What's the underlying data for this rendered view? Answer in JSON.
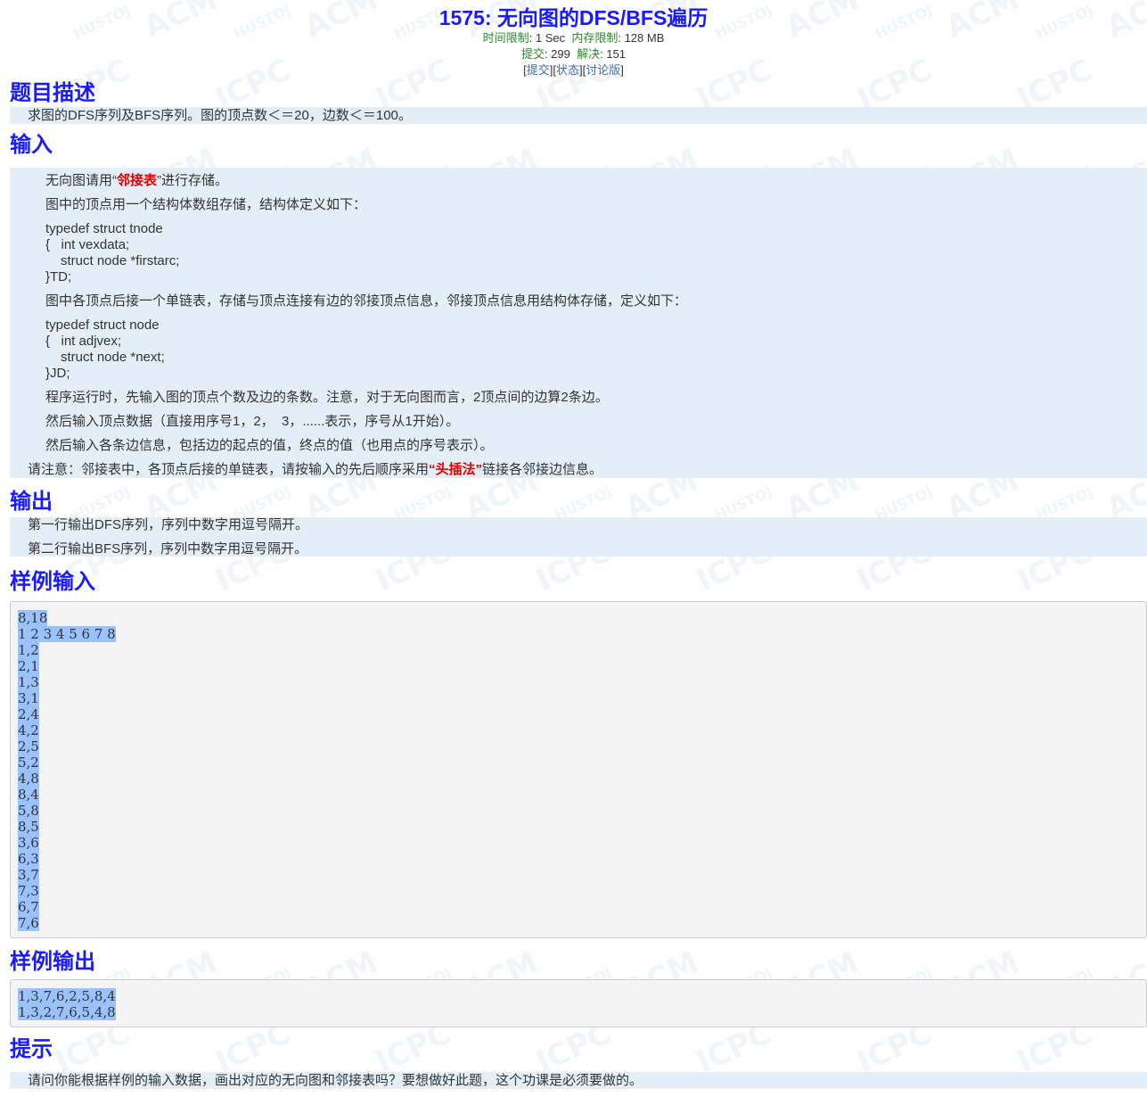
{
  "problem": {
    "title": "1575: 无向图的DFS/BFS遍历",
    "time_limit_label": "时间限制",
    "time_limit": ": 1 Sec",
    "memory_limit_label": "内存限制",
    "memory_limit": ": 128 MB",
    "submit_label": "提交",
    "submit_count": ": 299",
    "solved_label": "解决",
    "solved_count": ": 151",
    "link_submit": "提交",
    "link_status": "状态",
    "link_discuss": "讨论版",
    "bracket_open": "[",
    "bracket_close": "]"
  },
  "sections": {
    "description_title": "题目描述",
    "input_title": "输入",
    "output_title": "输出",
    "sample_input_title": "样例输入",
    "sample_output_title": "样例输出",
    "hint_title": "提示"
  },
  "description": "求图的DFS序列及BFS序列。图的顶点数＜＝20，边数＜＝100。",
  "input": {
    "p1_pre": "无向图请用“",
    "p1_red": "邻接表",
    "p1_post": "”进行存储。",
    "p2": "图中的顶点用一个结构体数组存储，结构体定义如下：",
    "code1": [
      "typedef struct tnode",
      "{   int vexdata;",
      "struct node *firstarc;",
      "}TD;"
    ],
    "p3": "图中各顶点后接一个单链表，存储与顶点连接有边的邻接顶点信息，邻接顶点信息用结构体存储，定义如下：",
    "code2": [
      "typedef struct node",
      "{   int adjvex;",
      "struct node *next;",
      "}JD;"
    ],
    "p4": "程序运行时，先输入图的顶点个数及边的条数。注意，对于无向图而言，2顶点间的边算2条边。",
    "p5": "然后输入顶点数据（直接用序号1，2，  3，......表示，序号从1开始）。",
    "p6": "然后输入各条边信息，包括边的起点的值，终点的值（也用点的序号表示）。",
    "note_pre": "请注意：邻接表中，各顶点后接的单链表，请按输入的先后顺序采用",
    "note_red": "“头插法”",
    "note_post": "链接各邻接边信息。"
  },
  "output": {
    "line1": "第一行输出DFS序列，序列中数字用逗号隔开。",
    "line2": "第二行输出BFS序列，序列中数字用逗号隔开。"
  },
  "sample_input": [
    "8,18",
    "1 2 3 4 5 6 7 8",
    "1,2",
    "2,1",
    "1,3",
    "3,1",
    "2,4",
    "4,2",
    "2,5",
    "5,2",
    "4,8",
    "8,4",
    "5,8",
    "8,5",
    "3,6",
    "6,3",
    "3,7",
    "7,3",
    "6,7",
    "7,6"
  ],
  "sample_output": [
    "1,3,7,6,2,5,8,4",
    "1,3,2,7,6,5,4,8"
  ],
  "hint": "请问你能根据样例的输入数据，画出对应的无向图和邻接表吗？要想做好此题，这个功课是必须要做的。",
  "watermark": [
    "HUSTOJ",
    "ACM",
    "ICPC"
  ],
  "colors": {
    "title": "#1a1aff",
    "label_green": "#2a8a2a",
    "link": "#3c6db0",
    "box_bg": "#e3eef7",
    "red": "#e00000",
    "selection": "#99c2ff"
  }
}
